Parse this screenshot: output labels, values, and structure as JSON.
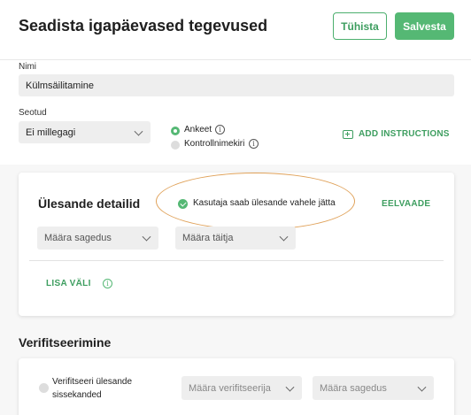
{
  "header": {
    "title": "Seadista igapäevased tegevused",
    "cancel_label": "Tühista",
    "save_label": "Salvesta"
  },
  "form": {
    "name_label": "Nimi",
    "name_value": "Külmsäilitamine",
    "linked_label": "Seotud",
    "linked_value": "Ei millegagi",
    "radios": [
      {
        "label": "Ankeet",
        "selected": true
      },
      {
        "label": "Kontrollnimekiri",
        "selected": false
      }
    ],
    "add_instructions": "ADD INSTRUCTIONS"
  },
  "task_details": {
    "title": "Ülesande detailid",
    "skip_checkbox_label": "Kasutaja saab ülesande vahele jätta",
    "preview_label": "EELVAADE",
    "frequency_placeholder": "Määra sagedus",
    "assignee_placeholder": "Määra täitja",
    "add_field_label": "LISA VÄLI"
  },
  "verification": {
    "title": "Verifitseerimine",
    "checkbox_label": "Verifitseeri ülesande sissekanded",
    "verifier_placeholder": "Määra verifitseerija",
    "frequency_placeholder": "Määra sagedus"
  },
  "colors": {
    "accent": "#55b874",
    "highlight": "#e0a25a"
  }
}
